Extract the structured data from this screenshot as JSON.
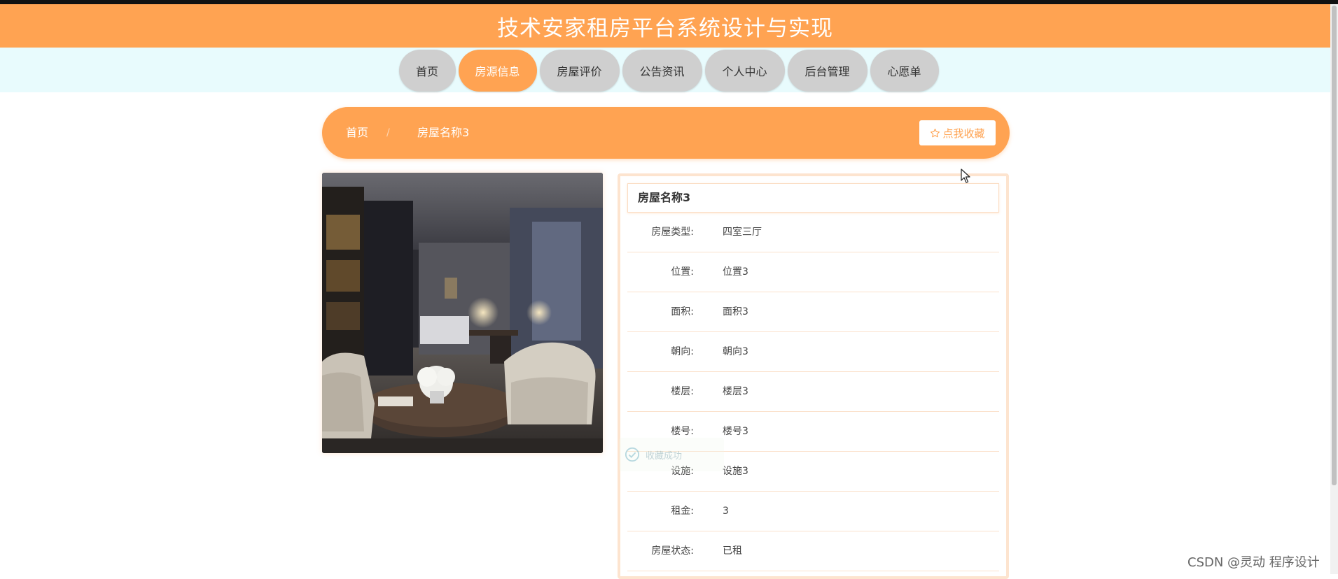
{
  "header": {
    "title": "技术安家租房平台系统设计与实现"
  },
  "nav": {
    "items": [
      {
        "label": "首页"
      },
      {
        "label": "房源信息"
      },
      {
        "label": "房屋评价"
      },
      {
        "label": "公告资讯"
      },
      {
        "label": "个人中心"
      },
      {
        "label": "后台管理"
      },
      {
        "label": "心愿单"
      }
    ],
    "active": "房源信息"
  },
  "breadcrumb": {
    "home": "首页",
    "separator": "/",
    "current": "房屋名称3"
  },
  "favorite_button": {
    "icon": "star-outline-icon",
    "label": "点我收藏"
  },
  "house": {
    "title": "房屋名称3",
    "fields": [
      {
        "label": "房屋类型:",
        "value": "四室三厅"
      },
      {
        "label": "位置:",
        "value": "位置3"
      },
      {
        "label": "面积:",
        "value": "面积3"
      },
      {
        "label": "朝向:",
        "value": "朝向3"
      },
      {
        "label": "楼层:",
        "value": "楼层3"
      },
      {
        "label": "楼号:",
        "value": "楼号3"
      },
      {
        "label": "设施:",
        "value": "设施3"
      },
      {
        "label": "租金:",
        "value": "3"
      },
      {
        "label": "房屋状态:",
        "value": "已租"
      }
    ]
  },
  "toast": {
    "icon": "success-icon",
    "text": "收藏成功"
  },
  "watermark": "CSDN @灵动 程序设计",
  "colors": {
    "accent": "#ffa352",
    "nav_band": "#e8fbfd",
    "nav_inactive": "#cfcfcf",
    "panel_border": "#fde4cf"
  }
}
